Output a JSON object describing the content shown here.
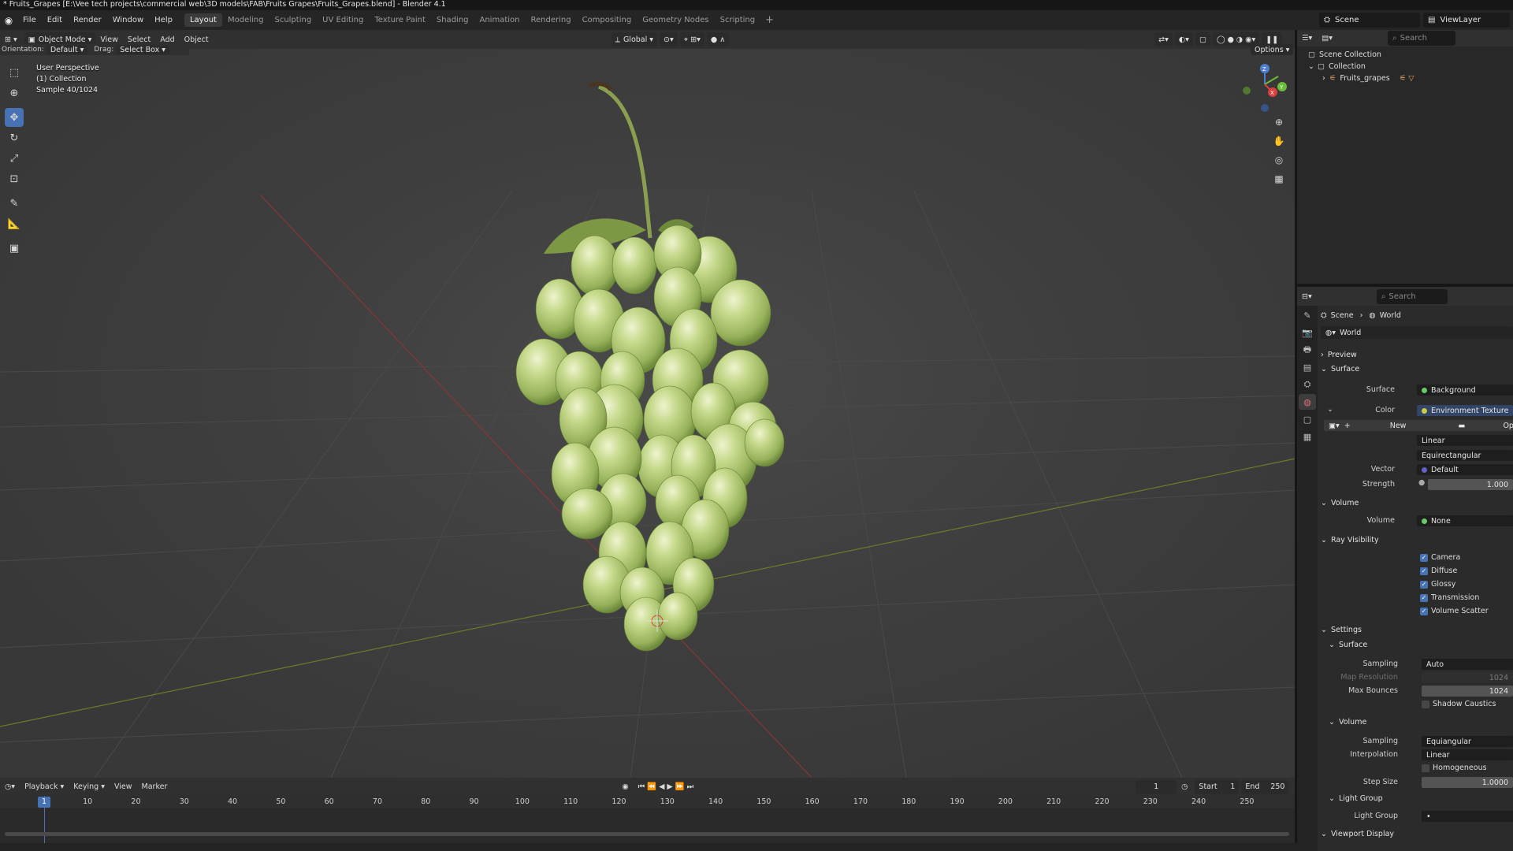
{
  "titlebar": {
    "text": "* Fruits_Grapes [E:\\Vee tech projects\\commercial web\\3D models\\FAB\\Fruits Grapes\\Fruits_Grapes.blend] - Blender 4.1"
  },
  "menu": [
    "File",
    "Edit",
    "Render",
    "Window",
    "Help"
  ],
  "workspaces": [
    "Layout",
    "Modeling",
    "Sculpting",
    "UV Editing",
    "Texture Paint",
    "Shading",
    "Animation",
    "Rendering",
    "Compositing",
    "Geometry Nodes",
    "Scripting"
  ],
  "active_workspace": "Layout",
  "scene": "Scene",
  "view_layer": "ViewLayer",
  "viewport_header": {
    "mode": "Object Mode",
    "menus": [
      "View",
      "Select",
      "Add",
      "Object"
    ],
    "transform": "Global",
    "options": "Options"
  },
  "viewport_header2": {
    "orientation_label": "Orientation:",
    "orientation": "Default",
    "drag_label": "Drag:",
    "drag": "Select Box"
  },
  "viewport_info": {
    "line1": "User Perspective",
    "line2": "(1) Collection",
    "line3": "Sample 40/1024"
  },
  "gizmo": {
    "z": "Z",
    "y": "Y",
    "x": "X"
  },
  "outliner": {
    "search_placeholder": "Search",
    "scene_collection": "Scene Collection",
    "collection": "Collection",
    "object": "Fruits_grapes"
  },
  "properties": {
    "search_placeholder": "Search",
    "breadcrumb_scene": "Scene",
    "breadcrumb_world": "World",
    "world_name": "World",
    "preview": "Preview",
    "surface_panel": "Surface",
    "surface_label": "Surface",
    "surface_value": "Background",
    "color_label": "Color",
    "color_value": "Environment Texture",
    "new_label": "New",
    "open_label": "Ope",
    "interp": "Linear",
    "projection": "Equirectangular",
    "vector_label": "Vector",
    "vector_value": "Default",
    "strength_label": "Strength",
    "strength_value": "1.000",
    "volume_panel": "Volume",
    "volume_label": "Volume",
    "volume_value": "None",
    "ray_visibility": "Ray Visibility",
    "rays": [
      {
        "label": "Camera",
        "checked": true
      },
      {
        "label": "Diffuse",
        "checked": true
      },
      {
        "label": "Glossy",
        "checked": true
      },
      {
        "label": "Transmission",
        "checked": true
      },
      {
        "label": "Volume Scatter",
        "checked": true
      }
    ],
    "settings": "Settings",
    "settings_surface": "Surface",
    "sampling_label": "Sampling",
    "sampling_value": "Auto",
    "map_res_label": "Map Resolution",
    "map_res_value": "1024",
    "max_bounces_label": "Max Bounces",
    "max_bounces_value": "1024",
    "shadow_caustics": "Shadow Caustics",
    "settings_volume": "Volume",
    "vol_sampling_label": "Sampling",
    "vol_sampling_value": "Equiangular",
    "interp_label": "Interpolation",
    "interp_value": "Linear",
    "homogeneous": "Homogeneous",
    "step_size_label": "Step Size",
    "step_size_value": "1.0000",
    "light_group_panel": "Light Group",
    "light_group_label": "Light Group",
    "viewport_display": "Viewport Display"
  },
  "timeline": {
    "menus": [
      "Playback",
      "Keying",
      "View",
      "Marker"
    ],
    "current_frame": "1",
    "start_label": "Start",
    "start": "1",
    "end_label": "End",
    "end": "250",
    "playhead": "1",
    "ticks": [
      "10",
      "20",
      "30",
      "40",
      "50",
      "60",
      "70",
      "80",
      "90",
      "100",
      "110",
      "120",
      "130",
      "140",
      "150",
      "160",
      "170",
      "180",
      "190",
      "200",
      "210",
      "220",
      "230",
      "240",
      "250"
    ]
  },
  "colors": {
    "accent": "#4772b3",
    "grape": "#b8cf7c",
    "leaf": "#6f8a3c",
    "stem": "#7f9446"
  }
}
